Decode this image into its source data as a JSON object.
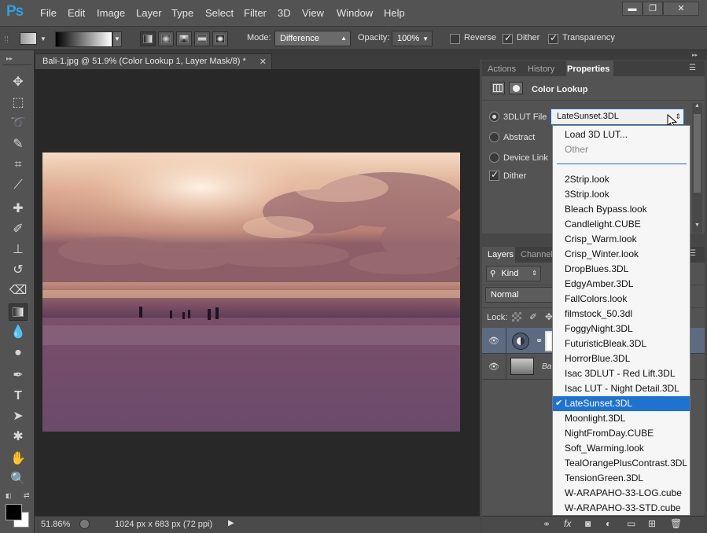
{
  "app": {
    "logo": "Ps"
  },
  "menu": [
    "File",
    "Edit",
    "Image",
    "Layer",
    "Type",
    "Select",
    "Filter",
    "3D",
    "View",
    "Window",
    "Help"
  ],
  "options_bar": {
    "mode_label": "Mode:",
    "mode_value": "Difference",
    "opacity_label": "Opacity:",
    "opacity_value": "100%",
    "reverse_label": "Reverse",
    "reverse_checked": false,
    "dither_label": "Dither",
    "dither_checked": true,
    "transparency_label": "Transparency",
    "transparency_checked": true
  },
  "document": {
    "tab_title": "Bali-1.jpg @ 51.9% (Color Lookup 1, Layer Mask/8) *",
    "zoom": "51.86%",
    "doc_info": "1024 px x 683 px (72 ppi)"
  },
  "panels": {
    "top_tabs": [
      "Actions",
      "History",
      "Properties"
    ],
    "active_top_tab": "Properties",
    "properties_title": "Color Lookup",
    "lut_file_label": "3DLUT File",
    "abstract_label": "Abstract",
    "device_link_label": "Device Link",
    "dither_label": "Dither",
    "selected_lut": "LateSunset.3DL",
    "layer_tabs": [
      "Layers",
      "Channel"
    ],
    "kind_label": "Kind",
    "blend_mode": "Normal",
    "lock_label": "Lock:"
  },
  "lut_menu": {
    "load_label": "Load 3D LUT...",
    "other_label": "Other",
    "items": [
      "2Strip.look",
      "3Strip.look",
      "Bleach Bypass.look",
      "Candlelight.CUBE",
      "Crisp_Warm.look",
      "Crisp_Winter.look",
      "DropBlues.3DL",
      "EdgyAmber.3DL",
      "FallColors.look",
      "filmstock_50.3dl",
      "FoggyNight.3DL",
      "FuturisticBleak.3DL",
      "HorrorBlue.3DL",
      "Isac 3DLUT - Red Lift.3DL",
      "Isac LUT - Night Detail.3DL",
      "LateSunset.3DL",
      "Moonlight.3DL",
      "NightFromDay.CUBE",
      "Soft_Warming.look",
      "TealOrangePlusContrast.3DL",
      "TensionGreen.3DL",
      "W-ARAPAHO-33-LOG.cube",
      "W-ARAPAHO-33-STD.cube"
    ],
    "selected_index": 15
  },
  "colors": {
    "accent": "#1e73d2",
    "ps_blue": "#29a3e0",
    "panel_bg": "#535353",
    "canvas_bg": "#282828"
  }
}
